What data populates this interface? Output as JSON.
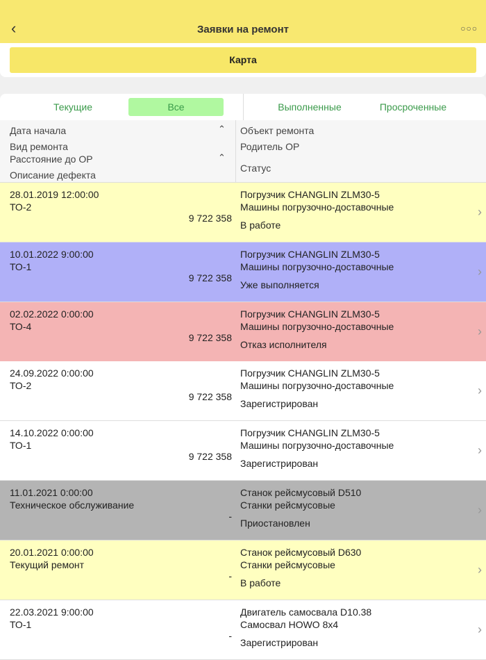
{
  "header": {
    "title": "Заявки на ремонт",
    "back_icon": "chevron-left-icon",
    "more_icon": "more-dots-icon"
  },
  "map_button": "Карта",
  "tabs": [
    {
      "label": "Текущие",
      "active": false
    },
    {
      "label": "Все",
      "active": true
    },
    {
      "label": "Выполненные",
      "active": false
    },
    {
      "label": "Просроченные",
      "active": false
    }
  ],
  "columns": {
    "start_date": "Дата начала",
    "repair_type": "Вид ремонта",
    "distance": "Расстояние до ОР",
    "defect": "Описание дефекта",
    "object": "Объект ремонта",
    "parent": "Родитель ОР",
    "status": "Статус"
  },
  "colors": {
    "yellow": "#ffffc0",
    "blue": "#b0b0f8",
    "red": "#f4b4b4",
    "grey": "#b4b4b4",
    "white": "#ffffff"
  },
  "rows": [
    {
      "date": "28.01.2019 12:00:00",
      "type": "ТО-2",
      "distance": "9 722 358",
      "object": "Погрузчик CHANGLIN ZLM30-5",
      "parent": "Машины погрузочно-доставочные",
      "status": "В работе",
      "color": "#ffffc0"
    },
    {
      "date": "10.01.2022 9:00:00",
      "type": "ТО-1",
      "distance": "9 722 358",
      "object": "Погрузчик CHANGLIN ZLM30-5",
      "parent": "Машины погрузочно-доставочные",
      "status": "Уже выполняется",
      "color": "#b0b0f8"
    },
    {
      "date": "02.02.2022 0:00:00",
      "type": "ТО-4",
      "distance": "9 722 358",
      "object": "Погрузчик CHANGLIN ZLM30-5",
      "parent": "Машины погрузочно-доставочные",
      "status": "Отказ исполнителя",
      "color": "#f4b4b4"
    },
    {
      "date": "24.09.2022 0:00:00",
      "type": "ТО-2",
      "distance": "9 722 358",
      "object": "Погрузчик CHANGLIN ZLM30-5",
      "parent": "Машины погрузочно-доставочные",
      "status": "Зарегистрирован",
      "color": "#ffffff"
    },
    {
      "date": "14.10.2022 0:00:00",
      "type": "ТО-1",
      "distance": "9 722 358",
      "object": "Погрузчик CHANGLIN ZLM30-5",
      "parent": "Машины погрузочно-доставочные",
      "status": "Зарегистрирован",
      "color": "#ffffff"
    },
    {
      "date": "11.01.2021 0:00:00",
      "type": "Техническое обслуживание",
      "distance": "-",
      "object": "Станок рейсмусовый D510",
      "parent": "Станки рейсмусовые",
      "status": "Приостановлен",
      "color": "#b4b4b4"
    },
    {
      "date": "20.01.2021 0:00:00",
      "type": "Текущий ремонт",
      "distance": "-",
      "object": "Станок рейсмусовый D630",
      "parent": "Станки рейсмусовые",
      "status": "В работе",
      "color": "#ffffc0"
    },
    {
      "date": "22.03.2021 9:00:00",
      "type": "ТО-1",
      "distance": "-",
      "object": "Двигатель самосвала D10.38",
      "parent": "Самосвал HOWO 8x4",
      "status": "Зарегистрирован",
      "color": "#ffffff"
    }
  ]
}
